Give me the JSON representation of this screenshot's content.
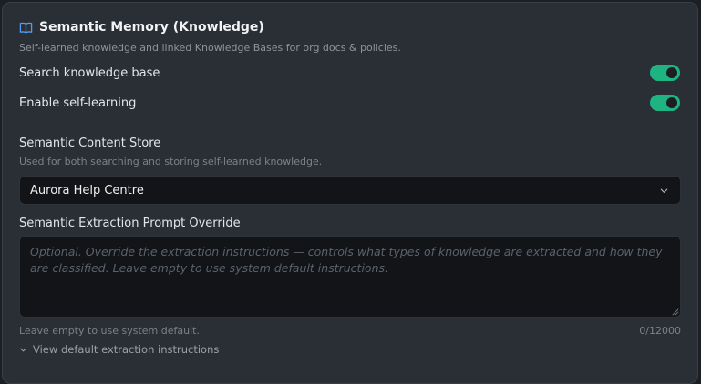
{
  "section": {
    "title": "Semantic Memory (Knowledge)",
    "subtitle": "Self-learned knowledge and linked Knowledge Bases for org docs & policies.",
    "icon": "book-open-icon",
    "icon_color": "#4f9cf0"
  },
  "toggles": [
    {
      "label": "Search knowledge base",
      "enabled": true
    },
    {
      "label": "Enable self-learning",
      "enabled": true
    }
  ],
  "toggle_on_color": "#1db482",
  "content_store": {
    "label": "Semantic Content Store",
    "helper": "Used for both searching and storing self-learned knowledge.",
    "selected": "Aurora Help Centre"
  },
  "prompt_override": {
    "label": "Semantic Extraction Prompt Override",
    "placeholder": "Optional. Override the extraction instructions — controls what types of knowledge are extracted and how they are classified. Leave empty to use system default instructions.",
    "footer_hint": "Leave empty to use system default.",
    "char_count": "0/12000"
  },
  "expander": {
    "label": "View default extraction instructions"
  }
}
